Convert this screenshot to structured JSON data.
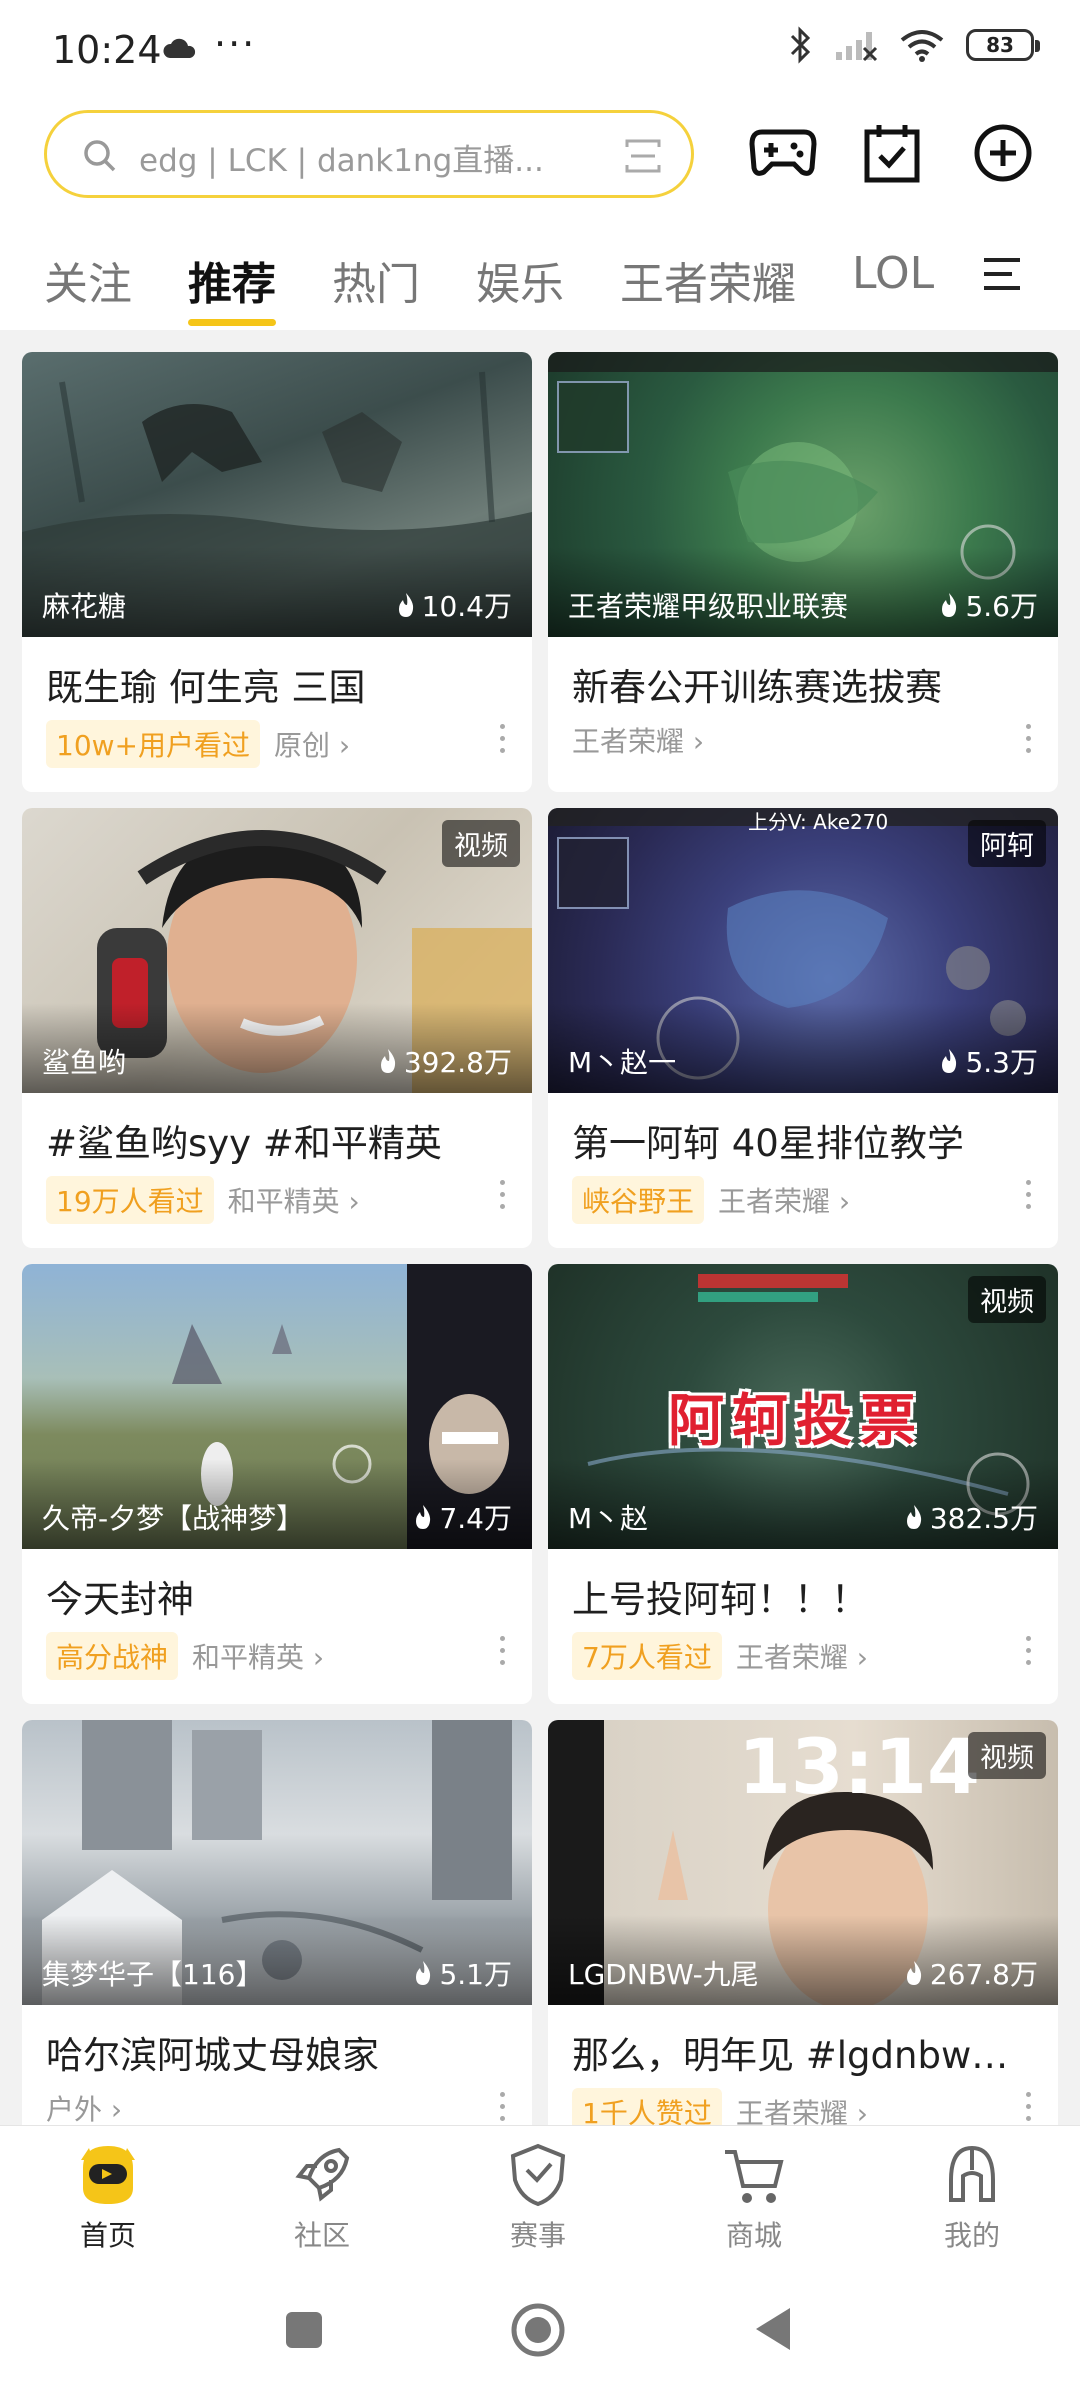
{
  "status_bar": {
    "time": "10:24",
    "battery": "83"
  },
  "search": {
    "placeholder": "edg | LCK | dank1ng直播..."
  },
  "tabs": [
    {
      "label": "关注"
    },
    {
      "label": "推荐"
    },
    {
      "label": "热门"
    },
    {
      "label": "娱乐"
    },
    {
      "label": "王者荣耀"
    },
    {
      "label": "LOL"
    }
  ],
  "cards": [
    {
      "streamer": "麻花糖",
      "heat": "10.4万",
      "corner_tag": "",
      "title": "既生瑜 何生亮 三国",
      "badge": "10w+用户看过",
      "category": "原创 ›"
    },
    {
      "streamer": "王者荣耀甲级职业联赛",
      "heat": "5.6万",
      "corner_tag": "",
      "title": "新春公开训练赛选拔赛",
      "badge": "",
      "category": "王者荣耀 ›"
    },
    {
      "streamer": "鲨鱼哟",
      "heat": "392.8万",
      "corner_tag": "视频",
      "title": "#鲨鱼哟syy #和平精英",
      "badge": "19万人看过",
      "category": "和平精英 ›"
    },
    {
      "streamer": "M丶赵一",
      "heat": "5.3万",
      "corner_tag": "阿轲",
      "title": "第一阿轲  40星排位教学",
      "badge": "峡谷野王",
      "category": "王者荣耀 ›"
    },
    {
      "streamer": "久帝-夕梦【战神梦】",
      "heat": "7.4万",
      "corner_tag": "",
      "title": "今天封神",
      "badge": "高分战神",
      "category": "和平精英 ›"
    },
    {
      "streamer": "M丶赵",
      "heat": "382.5万",
      "corner_tag": "视频",
      "title": "上号投阿轲！！！",
      "badge": "7万人看过",
      "category": "王者荣耀 ›"
    },
    {
      "streamer": "集梦华子【116】",
      "heat": "5.1万",
      "corner_tag": "",
      "title": "哈尔滨阿城丈母娘家",
      "badge": "",
      "category": "户外 ›"
    },
    {
      "streamer": "LGDNBW-九尾",
      "heat": "267.8万",
      "corner_tag": "视频",
      "title": "那么，明年见 #lgdnbw九...",
      "badge": "1千人赞过",
      "category": "王者荣耀 ›"
    }
  ],
  "thumb_overlays": {
    "card4_top": "上分V: Ake270",
    "card6_banner": "阿轲投票",
    "card8_clock": "13:14"
  },
  "bottom_nav": [
    {
      "label": "首页"
    },
    {
      "label": "社区"
    },
    {
      "label": "赛事"
    },
    {
      "label": "商城"
    },
    {
      "label": "我的"
    }
  ],
  "colors": {
    "accent": "#f5c518",
    "badge_text": "#f0a020",
    "badge_bg": "#fff5dc"
  }
}
